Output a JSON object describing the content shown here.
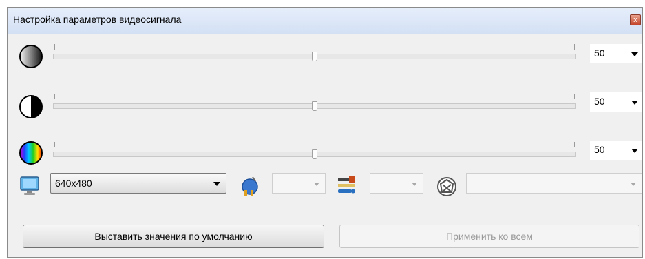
{
  "window": {
    "title": "Настройка параметров видеосигнала",
    "close_label": "x"
  },
  "sliders": [
    {
      "name": "brightness",
      "icon": "brightness-icon",
      "value": 50,
      "value_label": "50"
    },
    {
      "name": "contrast",
      "icon": "contrast-icon",
      "value": 50,
      "value_label": "50"
    },
    {
      "name": "saturation",
      "icon": "color-saturation-icon",
      "value": 50,
      "value_label": "50"
    }
  ],
  "resolution": {
    "icon": "monitor-icon",
    "value": "640x480"
  },
  "power": {
    "icon": "power-plug-icon",
    "value": ""
  },
  "tools": {
    "icon": "tools-icon",
    "value": ""
  },
  "standard": {
    "icon": "standard-badge-icon",
    "value": ""
  },
  "buttons": {
    "defaults_label": "Выставить значения по умолчанию",
    "apply_all_label": "Применить ко всем"
  },
  "colors": {
    "accent": "#4a7fc1",
    "title_bg": "#dce6f5",
    "close": "#c4452a"
  }
}
